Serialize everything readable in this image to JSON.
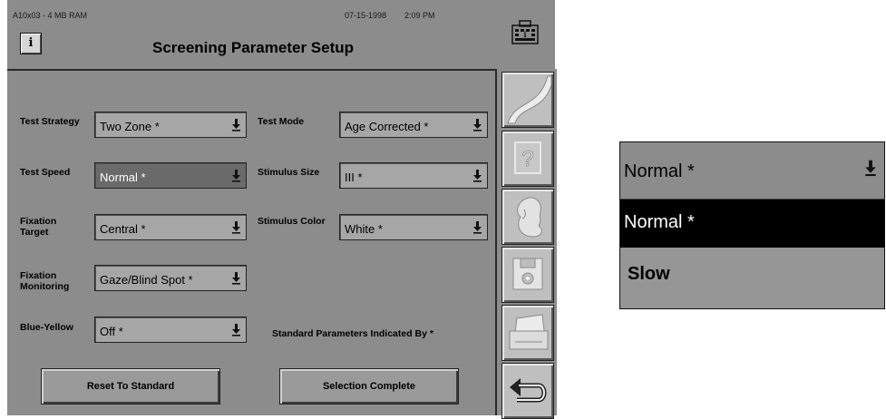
{
  "status": {
    "system_info": "A10x03 - 4 MB RAM",
    "date": "07-15-1998",
    "time": "2:09 PM"
  },
  "header": {
    "title": "Screening Parameter Setup",
    "info_button": "i"
  },
  "icons": [
    "keyboard-icon",
    "info-icon",
    "curve-icon",
    "help-icon",
    "patient-icon",
    "save-disk-icon",
    "printer-icon",
    "return-arrow-icon",
    "dropdown-arrow-icon"
  ],
  "form": {
    "test_strategy": {
      "label": "Test Strategy",
      "value": "Two Zone  *"
    },
    "test_mode": {
      "label": "Test Mode",
      "value": "Age Corrected  *"
    },
    "test_speed": {
      "label": "Test Speed",
      "value": "Normal  *"
    },
    "stimulus_size": {
      "label": "Stimulus Size",
      "value": "III  *"
    },
    "fixation_target": {
      "label": "Fixation\nTarget",
      "value": "Central  *"
    },
    "stimulus_color": {
      "label": "Stimulus Color",
      "value": "White  *"
    },
    "fixation_monitoring": {
      "label": "Fixation\nMonitoring",
      "value": "Gaze/Blind Spot *"
    },
    "blue_yellow": {
      "label": "Blue-Yellow",
      "value": "Off  *"
    },
    "standard_note": "Standard Parameters Indicated By *"
  },
  "buttons": {
    "reset": "Reset To Standard",
    "complete": "Selection Complete"
  },
  "zoom_dropdown": {
    "current": "Normal  *",
    "options": [
      "Normal  *",
      "Slow"
    ],
    "highlighted": "Normal  *"
  },
  "colors": {
    "screen_gray": "#8c8c8c",
    "selected_field": "#6a6a6a",
    "highlight": "#000000"
  }
}
